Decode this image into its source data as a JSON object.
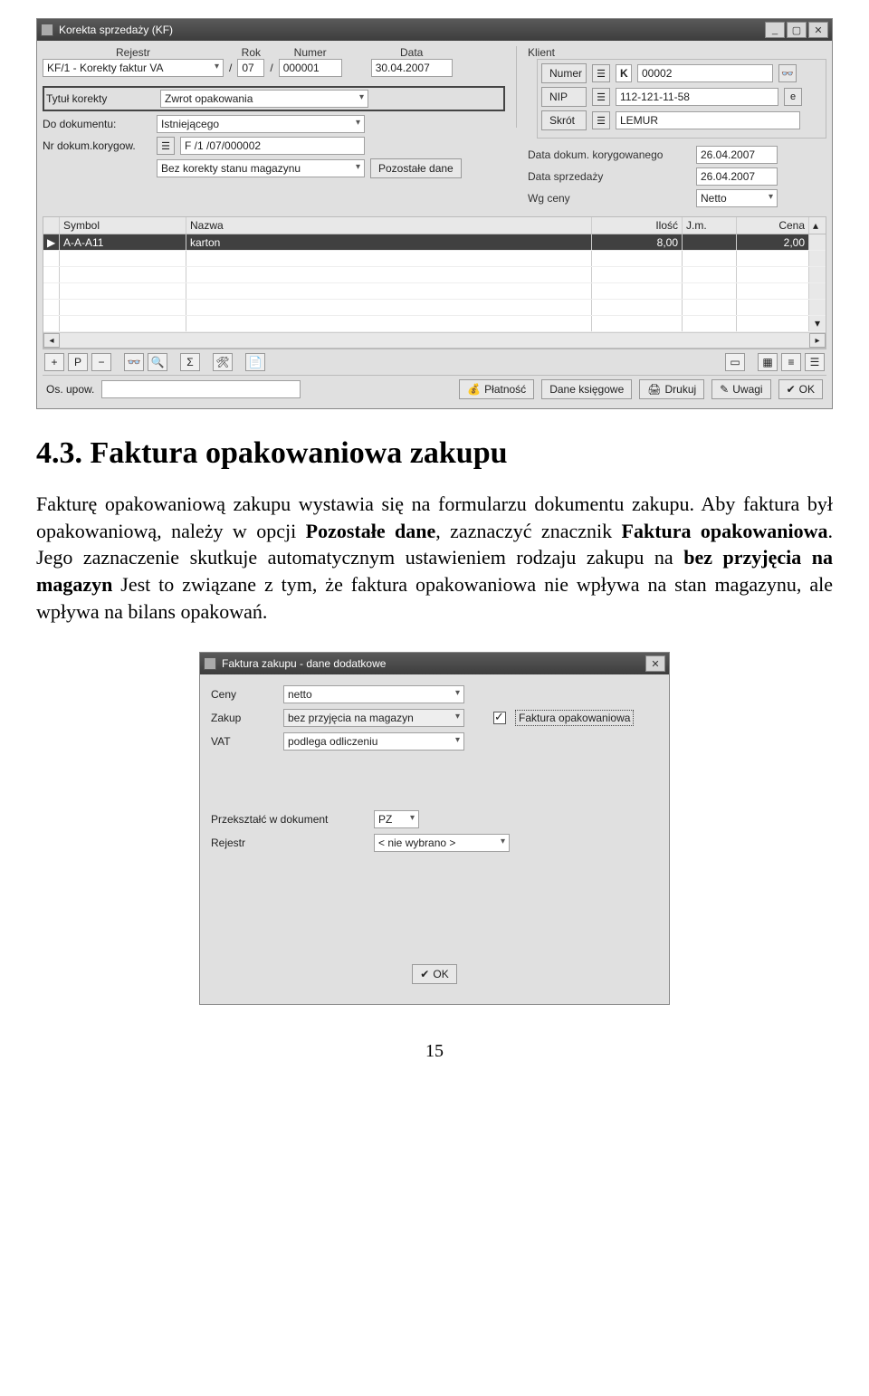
{
  "window1": {
    "title": "Korekta sprzedaży (KF)",
    "rejestr_label": "Rejestr",
    "rejestr_value": "KF/1  - Korekty faktur VA",
    "slash": "/",
    "rok_label": "Rok",
    "rok_value": "07",
    "numer_label": "Numer",
    "numer_value": "000001",
    "data_label": "Data",
    "data_value": "30.04.2007",
    "klient_label": "Klient",
    "klient": {
      "numer_label": "Numer",
      "kseria": "K",
      "numer_value": "00002",
      "nip_label": "NIP",
      "nip_value": "112-121-11-58",
      "skrot_label": "Skrót",
      "skrot_value": "LEMUR"
    },
    "tytul_label": "Tytuł korekty",
    "tytul_value": "Zwrot opakowania",
    "dodok_label": "Do dokumentu:",
    "dodok_value": "Istniejącego",
    "nrkor_label": "Nr dokum.korygow.",
    "nrkor_value": "F /1  /07/000002",
    "korekta_stanu": "Bez korekty stanu magazynu",
    "pozostale_btn": "Pozostałe dane",
    "r_data_kor_label": "Data dokum. korygowanego",
    "r_data_kor_value": "26.04.2007",
    "r_data_sprz_label": "Data sprzedaży",
    "r_data_sprz_value": "26.04.2007",
    "r_wg_ceny_label": "Wg ceny",
    "r_wg_ceny_value": "Netto",
    "table": {
      "headers": {
        "symbol": "Symbol",
        "nazwa": "Nazwa",
        "ilosc": "Ilość",
        "jm": "J.m.",
        "cena": "Cena"
      },
      "rows": [
        {
          "symbol": "A-A-A11",
          "nazwa": "karton",
          "ilosc": "8,00",
          "jm": "",
          "cena": "2,00"
        }
      ]
    },
    "os_upow_label": "Os. upow.",
    "buttons": {
      "platnosc": "Płatność",
      "dane_ksieg": "Dane księgowe",
      "drukuj": "Drukuj",
      "uwagi": "Uwagi",
      "ok": "OK"
    }
  },
  "text": {
    "heading": "4.3.   Faktura opakowaniowa zakupu",
    "p1a": "Fakturę opakowaniową zakupu wystawia się na formularzu dokumentu zakupu. Aby faktura był opakowaniową, należy w opcji ",
    "p1b": "Pozostałe dane",
    "p1c": ", zaznaczyć znacznik ",
    "p1d": "Faktura opakowaniowa",
    "p1e": ". Jego zaznaczenie skutkuje automatycznym ustawieniem rodzaju zakupu na ",
    "p1f": "bez przyjęcia na magazyn",
    "p1g": " Jest to związane z tym, że faktura opakowaniowa nie wpływa na stan magazynu, ale wpływa na bilans opakowań.",
    "pagenum": "15"
  },
  "dialog": {
    "title": "Faktura zakupu - dane dodatkowe",
    "ceny_label": "Ceny",
    "ceny_value": "netto",
    "zakup_label": "Zakup",
    "zakup_value": "bez przyjęcia na magazyn",
    "vat_label": "VAT",
    "vat_value": "podlega odliczeniu",
    "chk_label": "Faktura opakowaniowa",
    "trans_label": "Przekształć w dokument",
    "trans_value": "PZ",
    "rejestr_label": "Rejestr",
    "rejestr_value": "< nie wybrano >",
    "ok": "OK"
  }
}
